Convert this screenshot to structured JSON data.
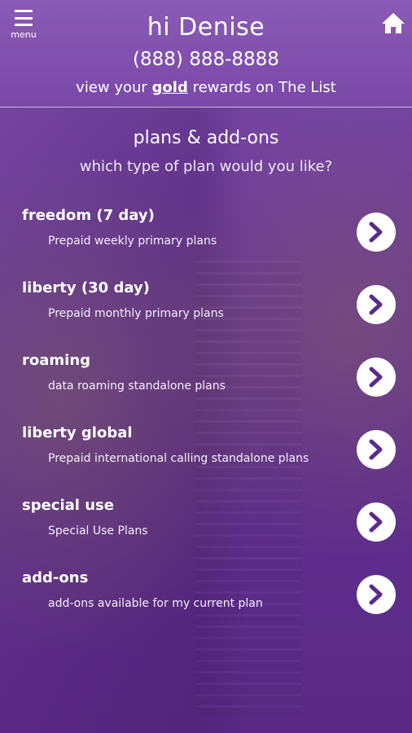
{
  "header": {
    "menu_label": "menu",
    "greeting": "hi Denise",
    "phone": "(888) 888-8888",
    "rewards_prefix": "view your ",
    "rewards_tier": "gold",
    "rewards_suffix": " rewards on The List"
  },
  "section": {
    "title": "plans & add-ons",
    "subtitle": "which type of plan would you like?"
  },
  "plans": [
    {
      "name": "freedom (7 day)",
      "description": "Prepaid weekly primary plans"
    },
    {
      "name": "liberty (30 day)",
      "description": "Prepaid monthly primary plans"
    },
    {
      "name": "roaming",
      "description": "data roaming standalone plans"
    },
    {
      "name": "liberty global",
      "description": "Prepaid international calling standalone plans"
    },
    {
      "name": "special use",
      "description": "Special Use Plans"
    },
    {
      "name": "add-ons",
      "description": "add-ons available for my current plan"
    }
  ],
  "colors": {
    "brand_purple": "#6a3997",
    "arrow_color": "#5b2a8a"
  },
  "icons": {
    "menu": "hamburger-icon",
    "home": "home-icon",
    "arrow": "chevron-right-icon"
  }
}
